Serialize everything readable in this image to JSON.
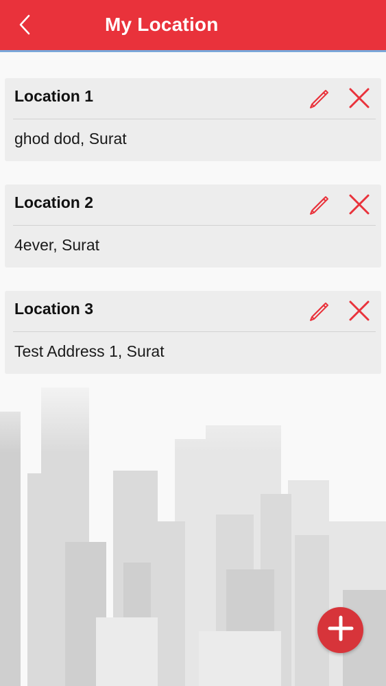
{
  "header": {
    "title": "My Location",
    "back_icon": "chevron-left-icon"
  },
  "colors": {
    "header_bg": "#e9323b",
    "header_border": "#7aa7d9",
    "accent_red": "#e9323b",
    "card_bg": "#ececec",
    "fab_bg": "#d7343a"
  },
  "locations": [
    {
      "title": "Location 1",
      "address": "ghod dod, Surat"
    },
    {
      "title": "Location 2",
      "address": "4ever, Surat"
    },
    {
      "title": "Location 3",
      "address": "Test Address 1, Surat"
    }
  ],
  "actions": {
    "edit_icon": "pencil-icon",
    "delete_icon": "close-icon",
    "add_icon": "plus-icon"
  }
}
